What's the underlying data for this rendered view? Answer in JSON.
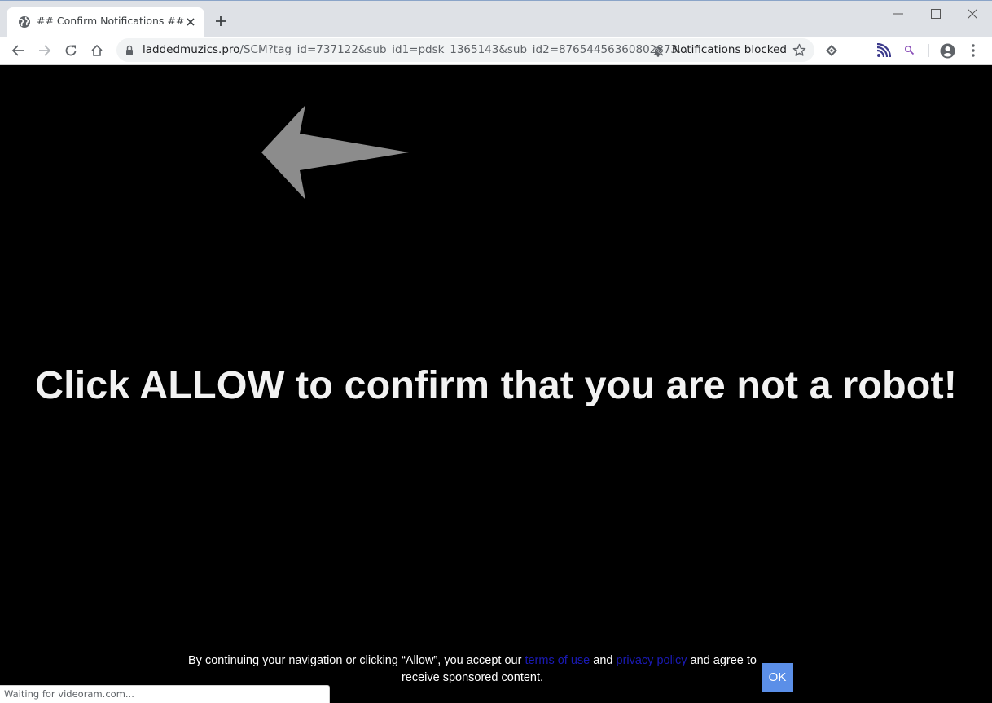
{
  "browser": {
    "tab": {
      "title": "## Confirm Notifications ##",
      "favicon": "globe-icon"
    },
    "window_controls": [
      "minimize",
      "maximize",
      "close"
    ],
    "toolbar": {
      "url_host": "laddedmuzics.pro",
      "url_rest": "/SCM?tag_id=737122&sub_id1=pdsk_1365143&sub_id2=87654456360802873...",
      "notifications_status": "Notifications blocked",
      "icons": [
        "back-icon",
        "forward-icon",
        "reload-icon",
        "home-icon",
        "lock-icon",
        "notifications-blocked-icon",
        "star-icon",
        "extension-icon",
        "feed-icon",
        "search-extension-icon",
        "profile-icon",
        "menu-icon"
      ]
    },
    "status_bar": "Waiting for videoram.com..."
  },
  "page": {
    "headline": "Click ALLOW to confirm that you are not a robot!",
    "consent": {
      "before": "By continuing your navigation or clicking “Allow”, you accept our ",
      "terms_link": "terms of use",
      "middle": " and ",
      "privacy_link": "privacy policy",
      "after": " and agree to receive sponsored content."
    },
    "ok_button": "OK",
    "arrow_color": "#8c8c8c",
    "ok_color": "#5b8fe8",
    "link_color": "#1a1ab5"
  }
}
